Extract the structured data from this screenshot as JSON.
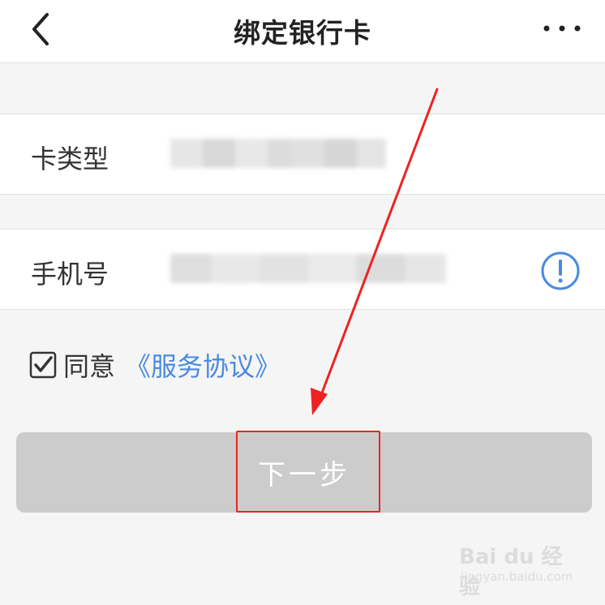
{
  "header": {
    "title": "绑定银行卡",
    "back_icon": "chevron-left-icon",
    "more_icon": "more-dots-icon"
  },
  "form": {
    "card_type_label": "卡类型",
    "phone_label": "手机号",
    "info_icon": "info-exclamation-icon"
  },
  "agreement": {
    "checked": true,
    "text": "同意",
    "link_text": "《服务协议》"
  },
  "next_button": {
    "label": "下一步"
  },
  "watermark": {
    "main": "Bai du 经验",
    "sub": "jingyan.baidu.com"
  },
  "colors": {
    "accent_blue": "#4a8ae0",
    "button_disabled": "#cccccc",
    "annotation_red": "#ee2222",
    "page_bg": "#f5f5f5"
  }
}
